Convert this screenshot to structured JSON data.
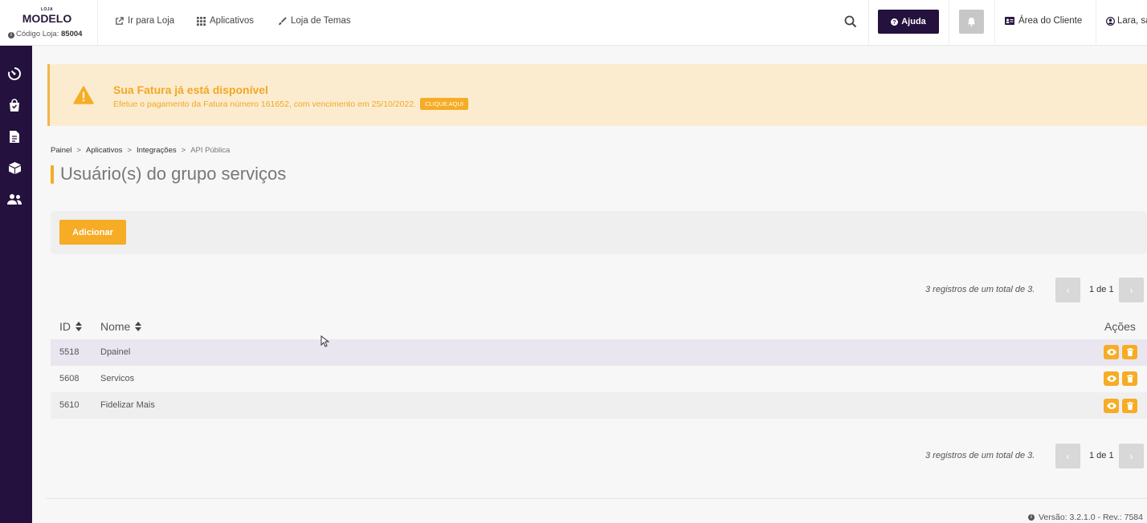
{
  "header": {
    "logo_small": "LOJA",
    "logo_big": "MODELO",
    "store_code_label": "Código Loja:",
    "store_code": "85004",
    "nav": [
      "Ir para Loja",
      "Aplicativos",
      "Loja de Temas"
    ],
    "help_label": "Ajuda",
    "client_area_label": "Área do Cliente",
    "user_label": "Lara, sa"
  },
  "alert": {
    "title": "Sua Fatura já está disponível",
    "text": "Efetue o pagamento da Fatura número 161652, com vencimento em 25/10/2022.",
    "button": "CLIQUE AQUI"
  },
  "breadcrumb": {
    "items": [
      "Painel",
      "Aplicativos",
      "Integrações"
    ],
    "current": "API Pública",
    "separator": ">"
  },
  "page_title": "Usuário(s) do grupo serviços",
  "add_button": "Adicionar",
  "pagination": {
    "summary": "3 registros de um total de 3.",
    "page": "1 de 1",
    "prev": "‹",
    "next": "›"
  },
  "table": {
    "headers": {
      "id": "ID",
      "name": "Nome",
      "actions": "Ações"
    },
    "rows": [
      {
        "id": "5518",
        "name": "Dpainel"
      },
      {
        "id": "5608",
        "name": "Servicos"
      },
      {
        "id": "5610",
        "name": "Fidelizar Mais"
      }
    ]
  },
  "footer": {
    "version": "Versão: 3.2.1.0 - Rev.: 7584"
  },
  "colors": {
    "accent": "#f6ac25",
    "dark": "#24113e",
    "alert_bg": "#fbecd0",
    "row_highlight": "#e9e6f0"
  }
}
